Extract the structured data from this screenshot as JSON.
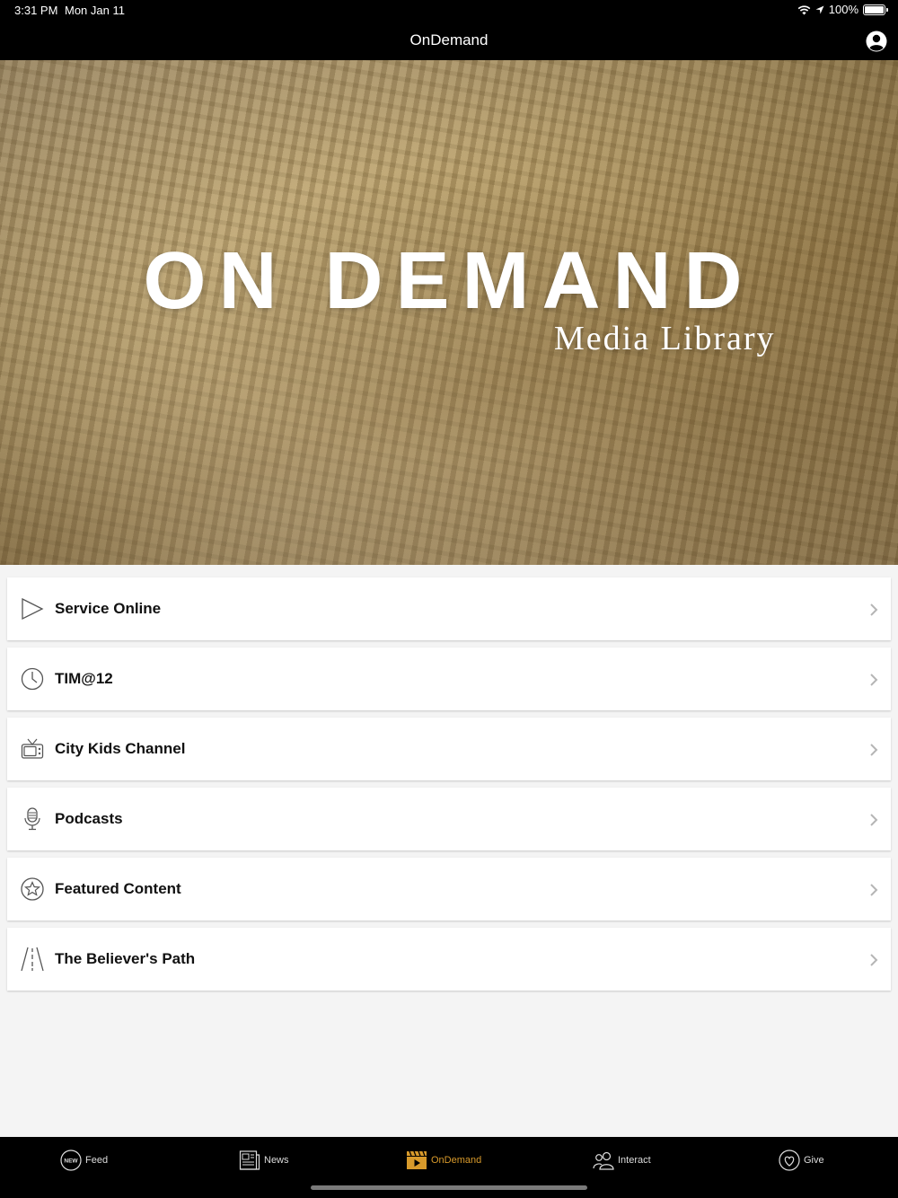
{
  "status_bar": {
    "time": "3:31 PM",
    "date": "Mon Jan 11",
    "battery": "100%"
  },
  "nav": {
    "title": "OnDemand"
  },
  "hero": {
    "title": "ON DEMAND",
    "subtitle": "Media Library"
  },
  "menu": {
    "items": [
      {
        "label": "Service Online",
        "icon": "play-icon"
      },
      {
        "label": "TIM@12",
        "icon": "clock-icon"
      },
      {
        "label": "City Kids Channel",
        "icon": "tv-icon"
      },
      {
        "label": "Podcasts",
        "icon": "microphone-icon"
      },
      {
        "label": "Featured Content",
        "icon": "star-icon"
      },
      {
        "label": "The Believer's Path",
        "icon": "road-icon"
      }
    ]
  },
  "tabs": [
    {
      "label": "Feed",
      "icon": "new-badge-icon",
      "active": false
    },
    {
      "label": "News",
      "icon": "newspaper-icon",
      "active": false
    },
    {
      "label": "OnDemand",
      "icon": "clapperboard-icon",
      "active": true
    },
    {
      "label": "Interact",
      "icon": "people-icon",
      "active": false
    },
    {
      "label": "Give",
      "icon": "heart-icon",
      "active": false
    }
  ],
  "colors": {
    "active_tab": "#d89a2b",
    "bar_background": "#000000",
    "page_background": "#f4f4f4"
  }
}
